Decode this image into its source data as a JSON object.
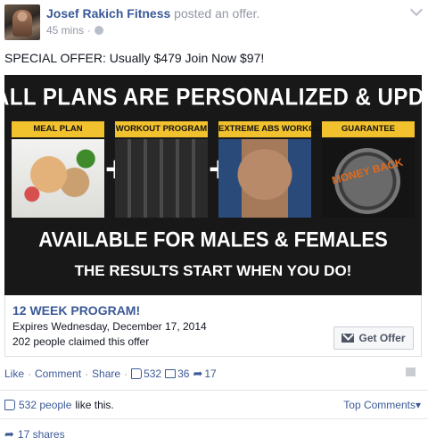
{
  "post": {
    "author": "Josef Rakich Fitness",
    "action": "posted an offer.",
    "time": "45 mins",
    "message": "SPECIAL OFFER: Usually $479 Join Now $97!"
  },
  "banner": {
    "headline": "ALL PLANS ARE PERSONALIZED & UPDATED MONTHLY",
    "tiles": [
      "MEAL PLAN",
      "WORKOUT PROGRAM",
      "EXTREME ABS WORKOUT",
      "GUARANTEE"
    ],
    "plus": "+",
    "badge": "MONEY BACK",
    "line1": "AVAILABLE FOR MALES & FEMALES",
    "line2": "THE RESULTS START WHEN YOU DO!"
  },
  "offer": {
    "title": "12 WEEK PROGRAM!",
    "expires": "Expires Wednesday, December 17, 2014",
    "claimed": "202 people claimed this offer",
    "button": "Get Offer"
  },
  "actions": {
    "like": "Like",
    "comment": "Comment",
    "share": "Share",
    "separator": "·",
    "likes_count": "532",
    "comments_count": "36",
    "shares_count": "17"
  },
  "summary": {
    "likes_people": "532 people",
    "likes_suffix": "like this.",
    "top_comments": "Top Comments",
    "shares": "17 shares"
  },
  "icons": [
    "globe-icon",
    "chevron-down-icon",
    "like-icon",
    "comment-icon",
    "share-icon",
    "flag-icon",
    "mail-icon"
  ],
  "colors": {
    "link": "#3b5998",
    "muted": "#9197a3",
    "banner_yellow": "#f2c12e"
  }
}
